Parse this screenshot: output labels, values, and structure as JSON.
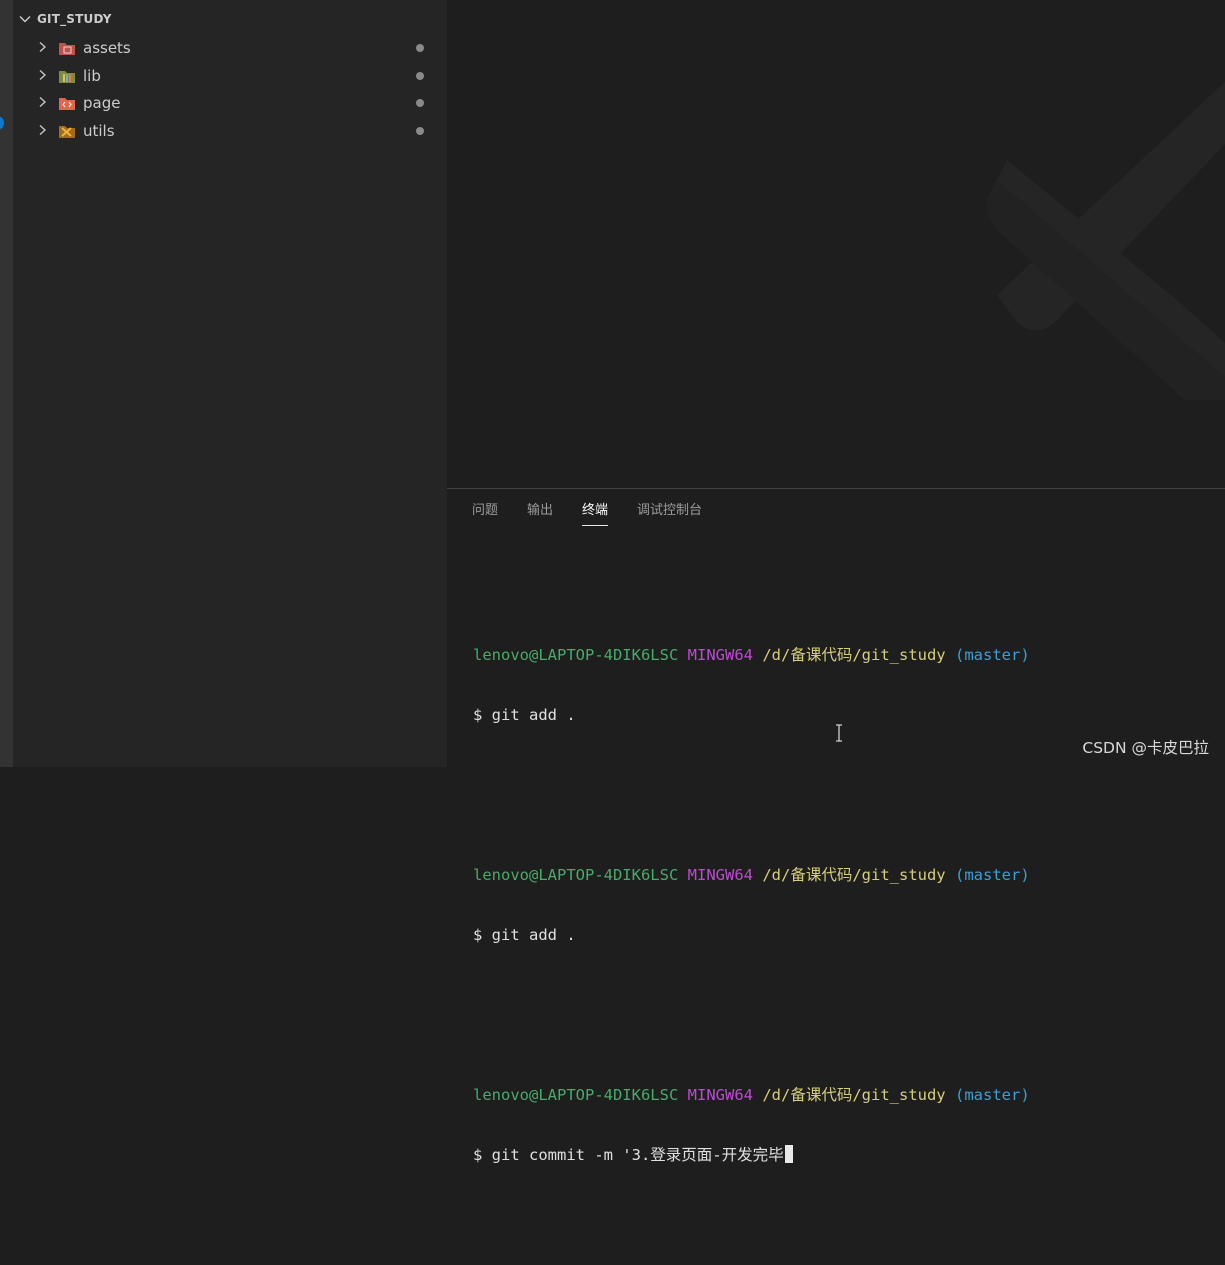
{
  "explorer": {
    "title": "GIT_STUDY",
    "items": [
      {
        "label": "assets",
        "icon": "folder-assets-icon",
        "color": "#c0524e"
      },
      {
        "label": "lib",
        "icon": "folder-lib-icon",
        "color": "#b0b64a"
      },
      {
        "label": "page",
        "icon": "folder-page-icon",
        "color": "#e2664d"
      },
      {
        "label": "utils",
        "icon": "folder-utils-icon",
        "color": "#e0a13a"
      }
    ]
  },
  "panel": {
    "tabs": [
      "问题",
      "输出",
      "终端",
      "调试控制台"
    ],
    "active_tab": "终端"
  },
  "terminal": {
    "blocks": [
      {
        "user": "lenovo@LAPTOP-4DIK6LSC",
        "host": "MINGW64",
        "path": "/d/备课代码/git_study",
        "branch": "(master)",
        "command": "$ git add ."
      },
      {
        "user": "lenovo@LAPTOP-4DIK6LSC",
        "host": "MINGW64",
        "path": "/d/备课代码/git_study",
        "branch": "(master)",
        "command": "$ git add ."
      },
      {
        "user": "lenovo@LAPTOP-4DIK6LSC",
        "host": "MINGW64",
        "path": "/d/备课代码/git_study",
        "branch": "(master)",
        "command": "$ git commit -m '3.登录页面-开发完毕"
      }
    ]
  },
  "watermark": "CSDN @卡皮巴拉",
  "colors": {
    "accent": "#0e7ad3",
    "user": "#4aa96b",
    "host": "#bc4bd1",
    "path": "#d6ce7a",
    "branch": "#3a9fd8"
  }
}
